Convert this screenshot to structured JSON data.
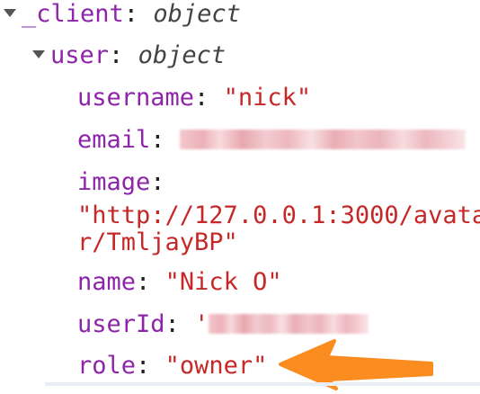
{
  "tree": {
    "client": {
      "key": "_client",
      "type": "object"
    },
    "user": {
      "key": "user",
      "type": "object"
    },
    "fields": {
      "username": {
        "key": "username",
        "value": "\"nick\""
      },
      "email": {
        "key": "email"
      },
      "image": {
        "key": "image",
        "value_line1": "\"http://127.0.0.1:3000/avata",
        "value_line2": "r/TmljayBP\""
      },
      "name": {
        "key": "name",
        "value": "\"Nick O\""
      },
      "userId": {
        "key": "userId",
        "value_prefix": "'"
      },
      "role": {
        "key": "role",
        "value": "\"owner\""
      }
    },
    "separator": ":"
  },
  "colors": {
    "key": "#8e24aa",
    "string": "#c62828",
    "arrow": "#fb8c1f"
  },
  "icons": {
    "expand": "chevron-down-icon",
    "annotation": "arrow-left-icon"
  }
}
